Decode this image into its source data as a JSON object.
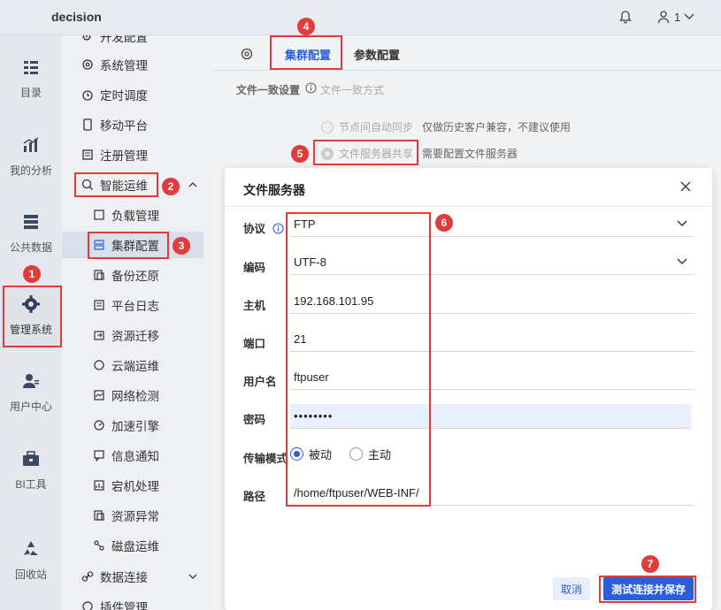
{
  "app": {
    "title": "decision",
    "user_count": "1"
  },
  "rail": [
    {
      "label": "目录",
      "icon": "catalog-icon"
    },
    {
      "label": "我的分析",
      "icon": "analysis-icon"
    },
    {
      "label": "公共数据",
      "icon": "database-icon"
    },
    {
      "label": "管理系统",
      "icon": "gear-icon"
    },
    {
      "label": "用户中心",
      "icon": "user-icon"
    },
    {
      "label": "BI工具",
      "icon": "toolbox-icon"
    },
    {
      "label": "回收站",
      "icon": "recycle-icon"
    }
  ],
  "nav": {
    "items": [
      {
        "label": "开发配置"
      },
      {
        "label": "系统管理"
      },
      {
        "label": "定时调度"
      },
      {
        "label": "移动平台"
      },
      {
        "label": "注册管理"
      },
      {
        "label": "智能运维"
      },
      {
        "label": "负载管理"
      },
      {
        "label": "集群配置"
      },
      {
        "label": "备份还原"
      },
      {
        "label": "平台日志"
      },
      {
        "label": "资源迁移"
      },
      {
        "label": "云端运维"
      },
      {
        "label": "网络检测"
      },
      {
        "label": "加速引擎"
      },
      {
        "label": "信息通知"
      },
      {
        "label": "宕机处理"
      },
      {
        "label": "资源异常"
      },
      {
        "label": "磁盘运维"
      },
      {
        "label": "数据连接"
      },
      {
        "label": "插件管理"
      }
    ]
  },
  "tabs": {
    "cluster": "集群配置",
    "params": "参数配置"
  },
  "consistency": {
    "title": "文件一致设置",
    "subtitle": "文件一致方式",
    "opt1": "节点间自动同步",
    "opt1_note": "仅做历史客户兼容，不建议使用",
    "opt2": "文件服务器共享",
    "opt2_note": "需要配置文件服务器"
  },
  "modal": {
    "title": "文件服务器",
    "labels": {
      "protocol": "协议",
      "encoding": "编码",
      "host": "主机",
      "port": "端口",
      "username": "用户名",
      "password": "密码",
      "mode": "传输模式",
      "path": "路径"
    },
    "values": {
      "protocol": "FTP",
      "encoding": "UTF-8",
      "host": "192.168.101.95",
      "port": "21",
      "username": "ftpuser",
      "password": "••••••••",
      "mode_passive": "被动",
      "mode_active": "主动",
      "path": "/home/ftpuser/WEB-INF/"
    },
    "cancel": "取消",
    "save": "测试连接并保存"
  },
  "annotations": [
    "1",
    "2",
    "3",
    "4",
    "5",
    "6",
    "7"
  ],
  "colors": {
    "accent": "#2b5fd9",
    "annotation": "#e23b3b"
  }
}
